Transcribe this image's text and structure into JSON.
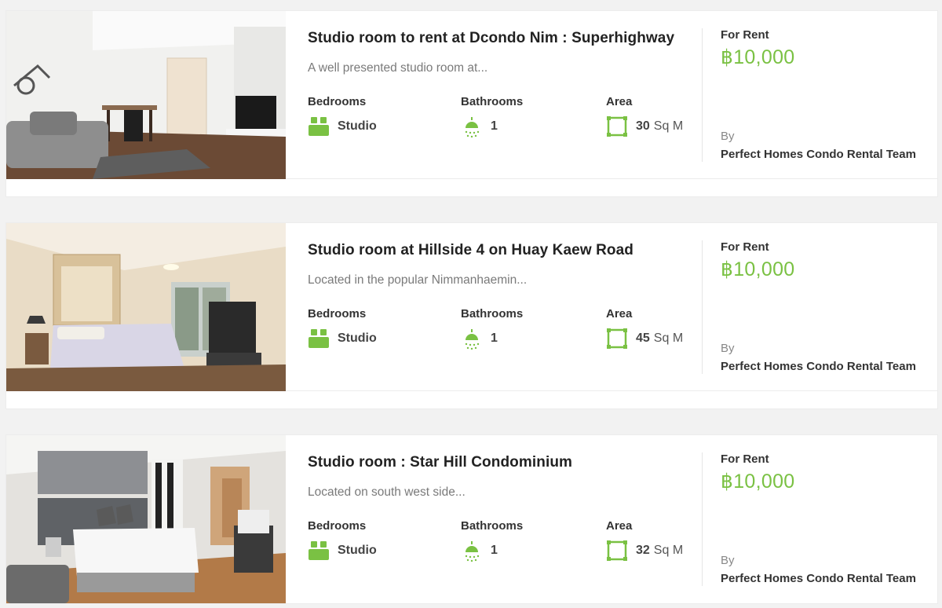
{
  "listings": [
    {
      "title": "Studio room to rent at Dcondo Nim : Superhighway",
      "description": "A well presented studio room at...",
      "bedrooms_label": "Bedrooms",
      "bedrooms_value": "Studio",
      "bathrooms_label": "Bathrooms",
      "bathrooms_value": "1",
      "area_label": "Area",
      "area_value": "30",
      "area_unit": "Sq M",
      "status": "For Rent",
      "price": "฿10,000",
      "by_label": "By",
      "agent": "Perfect Homes Condo Rental Team"
    },
    {
      "title": "Studio room at Hillside 4 on Huay Kaew Road",
      "description": "Located in the popular Nimmanhaemin...",
      "bedrooms_label": "Bedrooms",
      "bedrooms_value": "Studio",
      "bathrooms_label": "Bathrooms",
      "bathrooms_value": "1",
      "area_label": "Area",
      "area_value": "45",
      "area_unit": "Sq M",
      "status": "For Rent",
      "price": "฿10,000",
      "by_label": "By",
      "agent": "Perfect Homes Condo Rental Team"
    },
    {
      "title": "Studio room : Star Hill Condominium",
      "description": "Located on south west side...",
      "bedrooms_label": "Bedrooms",
      "bedrooms_value": "Studio",
      "bathrooms_label": "Bathrooms",
      "bathrooms_value": "1",
      "area_label": "Area",
      "area_value": "32",
      "area_unit": "Sq M",
      "status": "For Rent",
      "price": "฿10,000",
      "by_label": "By",
      "agent": "Perfect Homes Condo Rental Team"
    }
  ],
  "icons": {
    "bedrooms": "bed-icon",
    "bathrooms": "shower-icon",
    "area": "area-icon"
  },
  "colors": {
    "accent": "#7ac143",
    "background": "#f2f2f2"
  }
}
